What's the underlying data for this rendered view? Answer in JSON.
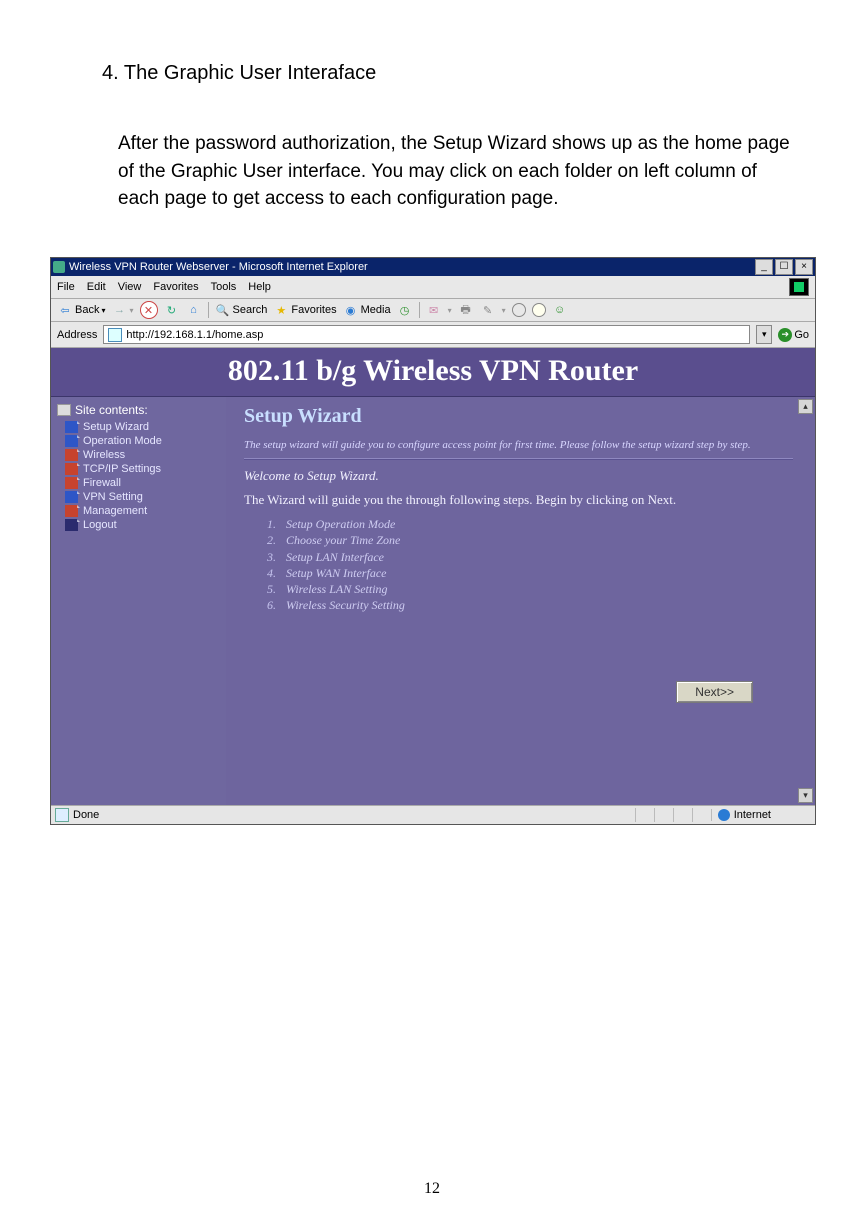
{
  "doc": {
    "heading": "4. The Graphic User Interaface",
    "paragraph": "After the password authorization, the Setup Wizard shows up as the home page of the Graphic User interface. You may click on each folder on left column of each page to get access to each configuration page.",
    "page_number": "12"
  },
  "ie": {
    "title": "Wireless VPN Router Webserver - Microsoft Internet Explorer",
    "menus": {
      "file": "File",
      "edit": "Edit",
      "view": "View",
      "favorites": "Favorites",
      "tools": "Tools",
      "help": "Help"
    },
    "toolbar": {
      "back": "Back",
      "search": "Search",
      "favorites": "Favorites",
      "media": "Media"
    },
    "address": {
      "label": "Address",
      "value": "http://192.168.1.1/home.asp",
      "go": "Go"
    },
    "status": {
      "done": "Done",
      "zone": "Internet"
    }
  },
  "router": {
    "banner": "802.11 b/g Wireless VPN Router",
    "sidebar": {
      "header": "Site contents:",
      "items": [
        "Setup Wizard",
        "Operation Mode",
        "Wireless",
        "TCP/IP Settings",
        "Firewall",
        "VPN Setting",
        "Management",
        "Logout"
      ]
    },
    "wizard": {
      "title": "Setup Wizard",
      "intro": "The setup wizard will guide you to configure access point for first time. Please follow the setup wizard step by step.",
      "welcome": "Welcome to Setup Wizard.",
      "guide": "The Wizard will guide you the through following steps. Begin by clicking on Next.",
      "steps": [
        "Setup Operation Mode",
        "Choose your Time Zone",
        "Setup LAN Interface",
        "Setup WAN Interface",
        "Wireless LAN Setting",
        "Wireless Security Setting"
      ],
      "next": "Next>>"
    }
  }
}
